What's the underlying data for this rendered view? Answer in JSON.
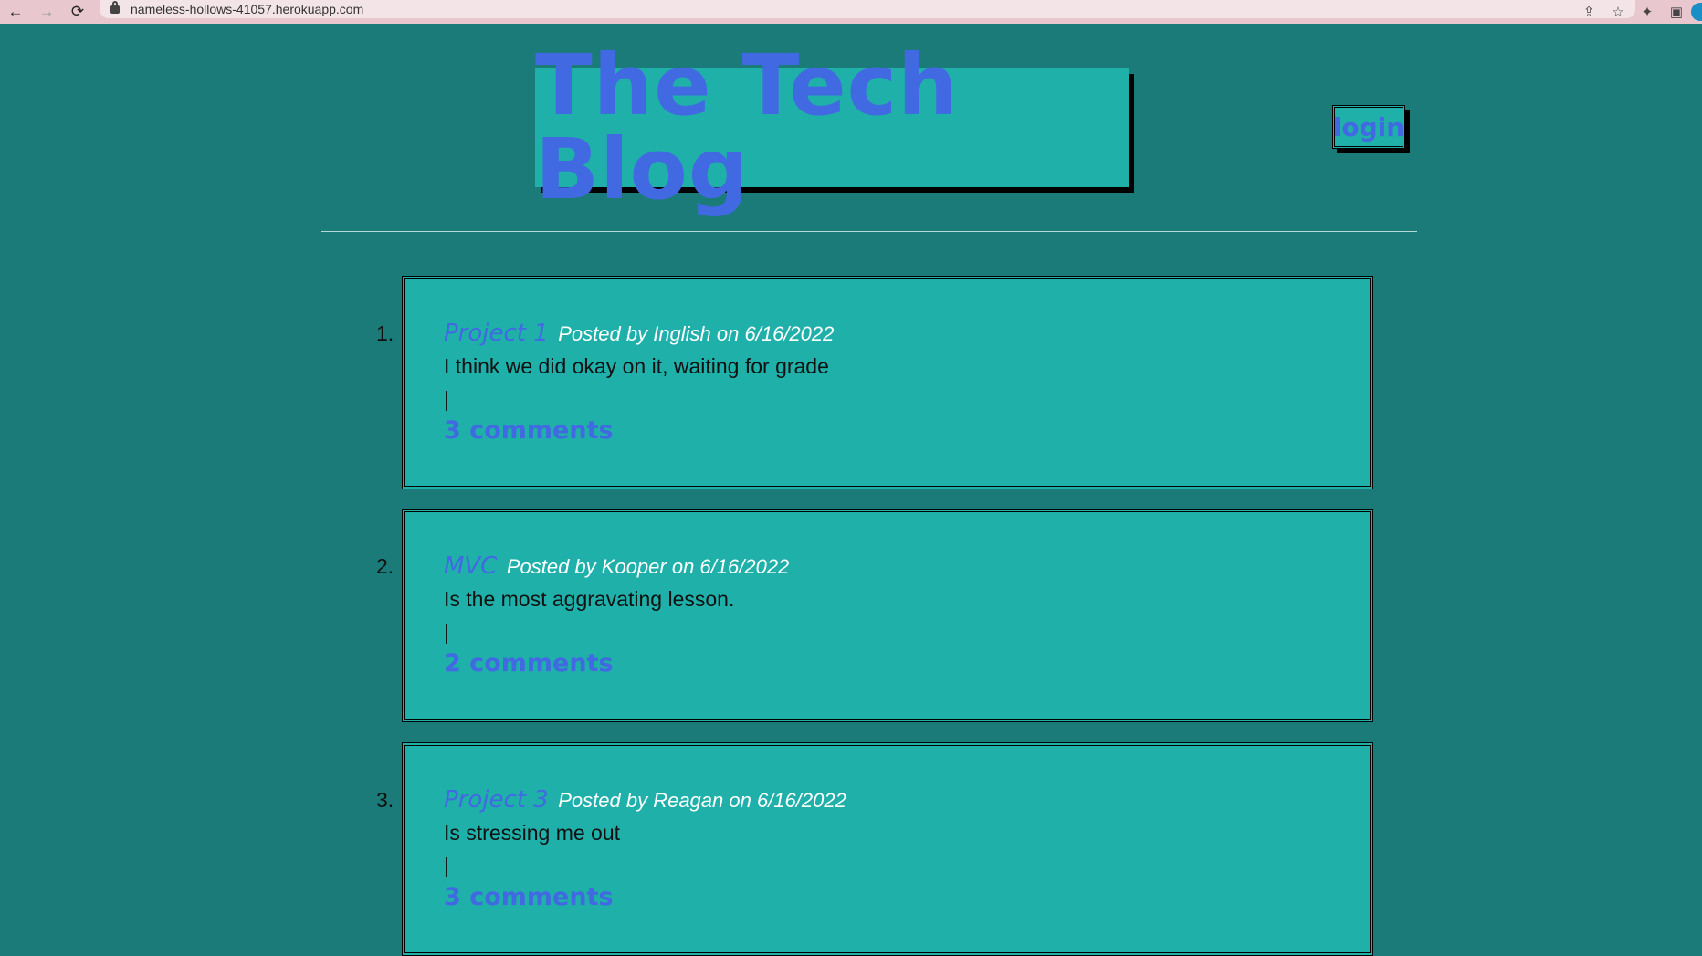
{
  "browser": {
    "url": "nameless-hollows-41057.herokuapp.com",
    "back_glyph": "←",
    "forward_glyph": "→",
    "reload_glyph": "⟳"
  },
  "header": {
    "title": "The Tech Blog",
    "login_label": "login"
  },
  "posts": [
    {
      "number": "1.",
      "title": "Project 1",
      "meta": "Posted by Inglish on 6/16/2022",
      "body": "I think we did okay on it, waiting for grade",
      "separator": "|",
      "comments": "3 comments"
    },
    {
      "number": "2.",
      "title": "MVC",
      "meta": "Posted by Kooper on 6/16/2022",
      "body": "Is the most aggravating lesson.",
      "separator": "|",
      "comments": "2 comments"
    },
    {
      "number": "3.",
      "title": "Project 3",
      "meta": "Posted by Reagan on 6/16/2022",
      "body": "Is stressing me out",
      "separator": "|",
      "comments": "3 comments"
    }
  ],
  "colors": {
    "page_background": "#1a7b79",
    "card_background": "#20b0aa",
    "accent_blue": "#4169e1",
    "meta_text": "#ffffff"
  }
}
